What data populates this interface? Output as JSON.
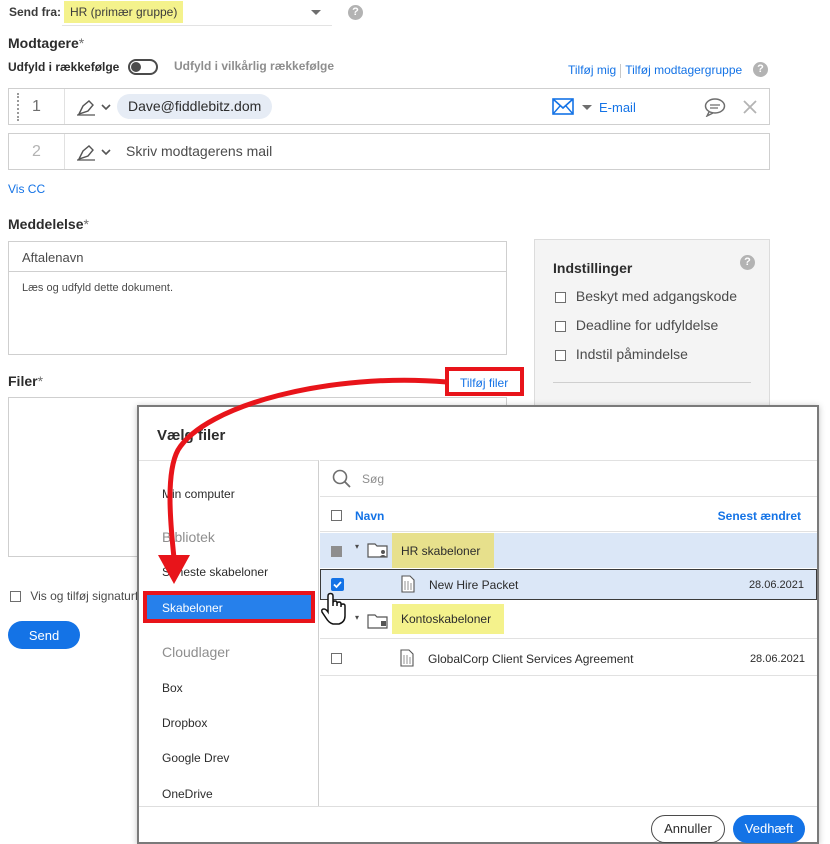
{
  "send_from": {
    "label": "Send fra:",
    "value": "HR (primær gruppe)"
  },
  "recipients": {
    "title": "Modtagere",
    "required_mark": "*",
    "order_left": "Udfyld i rækkefølge",
    "order_right": "Udfyld i vilkårlig rækkefølge",
    "add_me": "Tilføj mig",
    "add_group": "Tilføj modtagergruppe",
    "rows": [
      {
        "index": "1",
        "email": "Dave@fiddlebitz.dom",
        "delivery": "E-mail"
      },
      {
        "index": "2",
        "placeholder": "Skriv modtagerens mail"
      }
    ],
    "show_cc": "Vis CC"
  },
  "message": {
    "title": "Meddelelse",
    "agreement_name_placeholder": "Aftalenavn",
    "body": "Læs og udfyld dette dokument."
  },
  "settings": {
    "title": "Indstillinger",
    "options": [
      "Beskyt med adgangskode",
      "Deadline for udfyldelse",
      "Indstil påmindelse"
    ]
  },
  "files": {
    "title": "Filer",
    "add_files": "Tilføj filer"
  },
  "signature_option": "Vis og tilføj signaturfe",
  "send_button": "Send",
  "help_glyph": "?",
  "modal": {
    "title": "Vælg filer",
    "sources": {
      "my_computer": "Min computer",
      "library_header": "Bibliotek",
      "recent_templates": "Seneste skabeloner",
      "templates": "Skabeloner",
      "cloud_header": "Cloudlager",
      "cloud": [
        "Box",
        "Dropbox",
        "Google Drev",
        "OneDrive"
      ]
    },
    "search_placeholder": "Søg",
    "columns": {
      "name": "Navn",
      "modified": "Senest ændret"
    },
    "items": [
      {
        "type": "folder",
        "name": "HR skabeloner"
      },
      {
        "type": "file",
        "name": "New Hire Packet",
        "modified": "28.06.2021",
        "checked": true
      },
      {
        "type": "folder",
        "name": "Kontoskabeloner"
      },
      {
        "type": "file",
        "name": "GlobalCorp Client Services Agreement",
        "modified": "28.06.2021",
        "checked": false
      }
    ],
    "cancel": "Annuller",
    "attach": "Vedhæft"
  },
  "colors": {
    "accent": "#1473e6",
    "annotation_red": "#e8141a",
    "highlight": "#f4f28c"
  },
  "icons": [
    "help-icon",
    "chevron-down-icon",
    "pen-signer-icon",
    "mail-icon",
    "comment-icon",
    "close-icon",
    "search-icon",
    "folder-icon",
    "document-icon",
    "hand-cursor-icon",
    "annotation-arrow"
  ]
}
